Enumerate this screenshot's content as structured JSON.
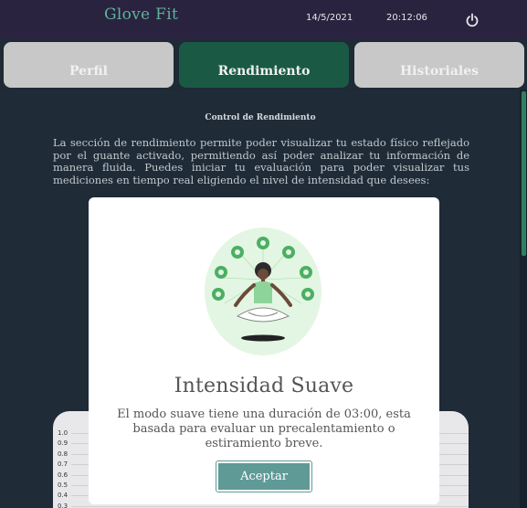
{
  "header": {
    "app_title": "Glove Fit",
    "date": "14/5/2021",
    "time": "20:12:06"
  },
  "tabs": [
    {
      "label": "Perfil"
    },
    {
      "label": "Rendimiento"
    },
    {
      "label": "Historiales"
    }
  ],
  "main": {
    "section_title": "Control de Rendimiento",
    "section_description": "La sección de rendimiento permite poder visualizar tu estado físico reflejado por el guante activado, permitiendo así poder analizar tu información de manera fluida. Puedes iniciar tu evaluación para poder visualizar tus mediciones en tiempo real eligiendo el nivel de intensidad que desees:",
    "chart_ticks": [
      "1.0",
      "0.9",
      "0.8",
      "0.7",
      "0.6",
      "0.5",
      "0.4",
      "0.3"
    ]
  },
  "modal": {
    "title": "Intensidad Suave",
    "text": "El modo suave tiene una duración de 03:00, esta basada para evaluar un precalentamiento o estiramiento breve.",
    "accept_label": "Aceptar"
  },
  "colors": {
    "accent": "#5fb39a",
    "active_tab": "#1a5a45",
    "button": "#5f9a97"
  }
}
